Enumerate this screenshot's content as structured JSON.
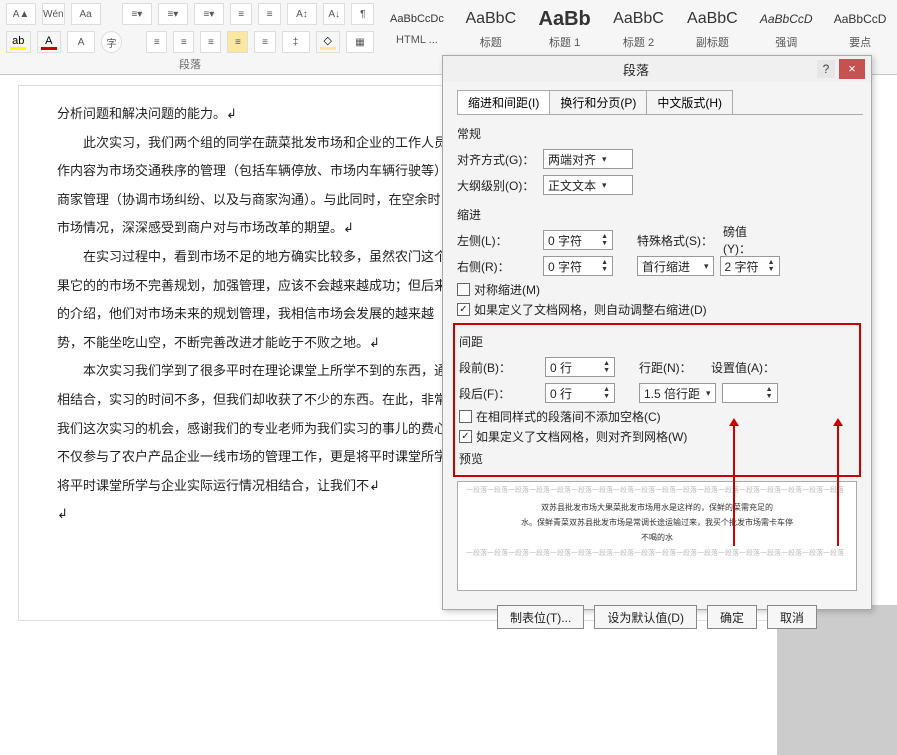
{
  "ribbon": {
    "group_paragraph": "段落",
    "btns": {
      "wen": "Wén",
      "aa": "Aa",
      "a_up": "A",
      "a_dn": "A"
    },
    "styles": [
      {
        "sample": "AaBbCcDc",
        "name": "HTML ..."
      },
      {
        "sample": "AaBbC",
        "name": "标题"
      },
      {
        "sample": "AaBb",
        "name": "标题 1"
      },
      {
        "sample": "AaBbC",
        "name": "标题 2"
      },
      {
        "sample": "AaBbC",
        "name": "副标题"
      },
      {
        "sample": "AaBbCcD",
        "name": "强调"
      },
      {
        "sample": "AaBbCcD",
        "name": "要点"
      }
    ]
  },
  "doc": {
    "p0": "分析问题和解决问题的能力。↲",
    "p1": "此次实习，我们两个组的同学在蔬菜批发市场和企业的工作人员",
    "p2": "作内容为市场交通秩序的管理（包括车辆停放、市场内车辆行驶等）",
    "p3": "商家管理（协调市场纠纷、以及与商家沟通）。与此同时，在空余时",
    "p4": "市场情况，深深感受到商户对与市场改革的期望。↲",
    "p5": "在实习过程中，看到市场不足的地方确实比较多，虽然农门这个",
    "p6": "果它的的市场不完善规划，加强管理，应该不会越来越成功；但后来",
    "p7": "的介绍，他们对市场未来的规划管理，我相信市场会发展的越来越",
    "p8": "势，不能坐吃山空，不断完善改进才能屹于不败之地。↲",
    "p9": "本次实习我们学到了很多平时在理论课堂上所学不到的东西，通",
    "p10": "相结合，实习的时间不多，但我们却收获了不少的东西。在此，非常",
    "p11": "我们这次实习的机会，感谢我们的专业老师为我们实习的事儿的费心",
    "p12": "不仅参与了农户产品企业一线市场的管理工作，更是将平时课堂所学",
    "p13": "将平时课堂所学与企业实际运行情况相结合，让我们不↲",
    "p14": "↲"
  },
  "dialog": {
    "title": "段落",
    "help": "?",
    "close": "×",
    "tabs": [
      "缩进和间距(I)",
      "换行和分页(P)",
      "中文版式(H)"
    ],
    "sect_general": "常规",
    "align_label": "对齐方式(G)：",
    "align_value": "两端对齐",
    "outline_label": "大纲级别(O)：",
    "outline_value": "正文文本",
    "sect_indent": "缩进",
    "left_label": "左侧(L)：",
    "left_value": "0 字符",
    "right_label": "右侧(R)：",
    "right_value": "0 字符",
    "special_label": "特殊格式(S)：",
    "special_value": "首行缩进",
    "measure_label": "磅值(Y)：",
    "measure_value": "2 字符",
    "sym_indent": "对称缩进(M)",
    "auto_grid": "如果定义了文档网格，则自动调整右缩进(D)",
    "sect_spacing": "间距",
    "before_label": "段前(B)：",
    "before_value": "0 行",
    "after_label": "段后(F)：",
    "after_value": "0 行",
    "line_label": "行距(N)：",
    "line_value": "1.5 倍行距",
    "set_label": "设置值(A)：",
    "set_value": "",
    "no_space_same": "在相同样式的段落间不添加空格(C)",
    "snap_grid": "如果定义了文档网格，则对齐到网格(W)",
    "preview_label": "预览",
    "preview_filler": "一段落一段落一段落一段落一段落一段落一段落一段落一段落一段落一段落一段落一段落一段落一段落一段落一段落一段落",
    "preview_main1": "双苏县批发市场大果菜批发市场用水是这样的，保鲜的菜需充足的",
    "preview_main2": "水。保鲜青菜双苏县批发市场是常调长途运输过来，我买个批发市场需卡车停",
    "preview_main3": "不喝的水",
    "btn_tabs": "制表位(T)...",
    "btn_default": "设为默认值(D)",
    "btn_ok": "确定",
    "btn_cancel": "取消"
  }
}
